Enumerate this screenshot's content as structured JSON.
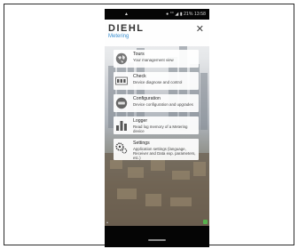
{
  "status_bar": {
    "left": "▲",
    "right": "● °° ◢ ▮ 21% 13:58"
  },
  "app": {
    "brand": "DIEHL",
    "sub_brand": "Metering",
    "close_icon": "close-icon"
  },
  "menu": [
    {
      "title": "Tours",
      "description": "Your management view",
      "icon": "globe-icon"
    },
    {
      "title": "Check",
      "description": "Device diagnose and control",
      "icon": "counter-icon"
    },
    {
      "title": "Configuration",
      "description": "Device configuration and upgrades",
      "icon": "router-icon"
    },
    {
      "title": "Logger",
      "description": "Read log memory of a Metering device",
      "icon": "bar-chart-icon"
    },
    {
      "title": "Settings",
      "description": "Application settings (language, Receiver and Data exp. parameters, etc.)",
      "icon": "gears-icon"
    }
  ],
  "colors": {
    "accent": "#3b8fd0",
    "status_green": "#56b14d"
  }
}
